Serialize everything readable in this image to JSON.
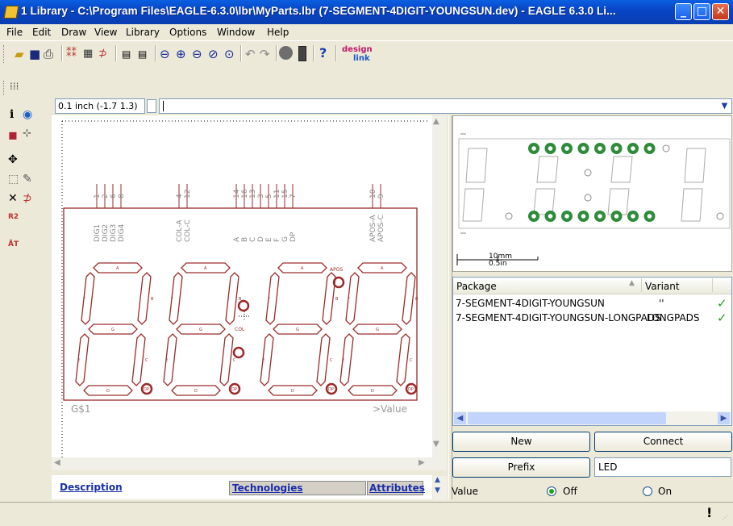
{
  "window": {
    "title": "1 Library - C:\\Program Files\\EAGLE-6.3.0\\lbr\\MyParts.lbr (7-SEGMENT-4DIGIT-YOUNGSUN.dev) - EAGLE 6.3.0 Li..."
  },
  "menu": [
    "File",
    "Edit",
    "Draw",
    "View",
    "Library",
    "Options",
    "Window",
    "Help"
  ],
  "toolbar": {
    "icons": [
      "open-icon",
      "save-icon",
      "print-icon",
      "symbol-icon",
      "package-icon",
      "device-icon",
      "script-icon",
      "ulp-icon",
      "zoom-fit-icon",
      "zoom-in-icon",
      "zoom-out-icon",
      "zoom-redraw-icon",
      "zoom-select-icon",
      "undo-icon",
      "redo-icon",
      "stop-icon",
      "go-icon",
      "help-icon",
      "design-link-icon"
    ],
    "design_link": "design",
    "design_link_sub": "link"
  },
  "coordinates": "0.1 inch (-1.7 1.3)",
  "command_line": "",
  "schematic": {
    "pin_numbers": [
      "1",
      "2",
      "6",
      "8",
      "4",
      "12",
      "14",
      "16",
      "13",
      "3",
      "5",
      "11",
      "15",
      "7",
      "10",
      "9"
    ],
    "pin_names": [
      "DIG1",
      "DIG2",
      "DIG3",
      "DIG4",
      "COL-A",
      "COL-C",
      "A",
      "B",
      "C",
      "D",
      "E",
      "F",
      "G",
      "DP",
      "APOS-A",
      "APOS-C"
    ],
    "segment_labels": [
      "A",
      "F",
      "B",
      "G",
      "E",
      "C",
      "D",
      "DP"
    ],
    "col_label": "COL",
    "apos_label": "APOS",
    "name_label": "G$1",
    "value_label": ">Value"
  },
  "preview": {
    "scale_mm": "10mm",
    "scale_in": "0.5in"
  },
  "package_list": {
    "columns": [
      "Package",
      "Variant"
    ],
    "rows": [
      {
        "package": "7-SEGMENT-4DIGIT-YOUNGSUN",
        "variant": "''",
        "check": "✓"
      },
      {
        "package": "7-SEGMENT-4DIGIT-YOUNGSUN-LONGPADS",
        "variant": "LONGPADS",
        "check": "✓"
      }
    ]
  },
  "buttons": {
    "new": "New",
    "connect": "Connect",
    "prefix": "Prefix"
  },
  "prefix_value": "LED",
  "value_section": {
    "label": "Value",
    "off": "Off",
    "on": "On",
    "selected": "Off"
  },
  "tabs": {
    "description": "Description",
    "technologies": "Technologies",
    "attributes": "Attributes"
  },
  "status": {
    "icon": "!"
  }
}
